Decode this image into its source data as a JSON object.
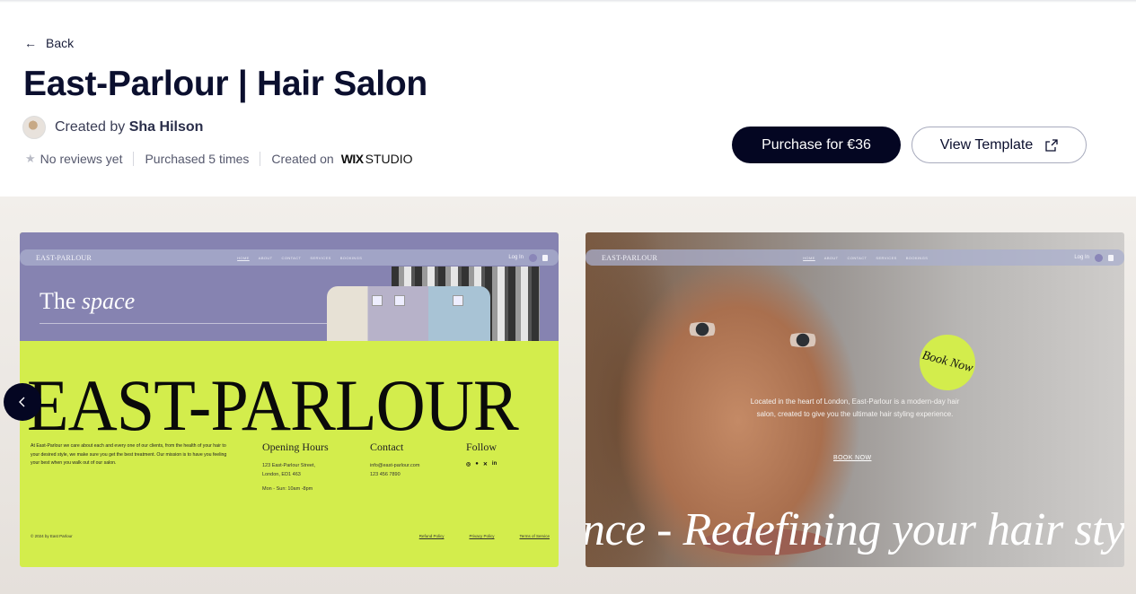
{
  "header": {
    "back_label": "Back",
    "title": "East-Parlour | Hair Salon",
    "created_by_prefix": "Created by",
    "creator_name": "Sha Hilson",
    "reviews": "No reviews yet",
    "purchases": "Purchased 5 times",
    "created_on": "Created on",
    "platform_bold": "WIX",
    "platform_rest": "STUDIO",
    "purchase_label": "Purchase for €36",
    "view_label": "View Template"
  },
  "colors": {
    "primary": "#040622",
    "accent_lime": "#d3ed4c",
    "accent_purple": "#8683b1"
  },
  "preview": {
    "nav": {
      "logo": "EAST-PARLOUR",
      "links": [
        "HOME",
        "ABOUT",
        "CONTACT",
        "SERVICES",
        "BOOKINGS"
      ],
      "login": "Log In"
    },
    "card1": {
      "heading_plain": "The",
      "heading_italic": "space",
      "big_title": "EAST-PARLOUR",
      "paragraph": "At East-Parlour we care about each and every one of our clients, from the health of your hair to your desired style, we make sure you get the best treatment. Our mission is to have you feeling your best when you walk out of our salon.",
      "hours_title": "Opening Hours",
      "address_1": "123 East-Parlour Street,",
      "address_2": "London, ED1 463",
      "hours": "Mon - Sun: 10am -8pm",
      "contact_title": "Contact",
      "email": "info@east-parlour.com",
      "phone": "123 456 7890",
      "follow_title": "Follow",
      "copyright": "© 2024 by East Parlour",
      "footer_links": [
        "Refund Policy",
        "Privacy Policy",
        "Terms of Service"
      ]
    },
    "card2": {
      "badge": "Book Now",
      "paragraph": "Located in the heart of London, East-Parlour is a modern-day hair salon, created to give you the ultimate hair styling experience.",
      "cta": "BOOK NOW",
      "marquee": "nce - Redefining your hair styling"
    }
  }
}
